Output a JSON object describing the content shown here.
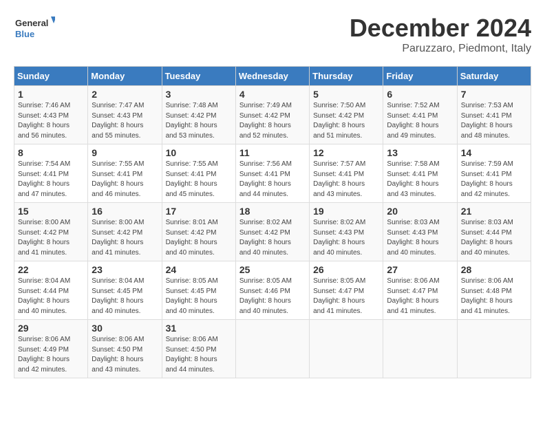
{
  "header": {
    "logo_line1": "General",
    "logo_line2": "Blue",
    "month": "December 2024",
    "location": "Paruzzaro, Piedmont, Italy"
  },
  "weekdays": [
    "Sunday",
    "Monday",
    "Tuesday",
    "Wednesday",
    "Thursday",
    "Friday",
    "Saturday"
  ],
  "weeks": [
    [
      {
        "day": "1",
        "sunrise": "7:46 AM",
        "sunset": "4:43 PM",
        "daylight": "8 hours and 56 minutes."
      },
      {
        "day": "2",
        "sunrise": "7:47 AM",
        "sunset": "4:43 PM",
        "daylight": "8 hours and 55 minutes."
      },
      {
        "day": "3",
        "sunrise": "7:48 AM",
        "sunset": "4:42 PM",
        "daylight": "8 hours and 53 minutes."
      },
      {
        "day": "4",
        "sunrise": "7:49 AM",
        "sunset": "4:42 PM",
        "daylight": "8 hours and 52 minutes."
      },
      {
        "day": "5",
        "sunrise": "7:50 AM",
        "sunset": "4:42 PM",
        "daylight": "8 hours and 51 minutes."
      },
      {
        "day": "6",
        "sunrise": "7:52 AM",
        "sunset": "4:41 PM",
        "daylight": "8 hours and 49 minutes."
      },
      {
        "day": "7",
        "sunrise": "7:53 AM",
        "sunset": "4:41 PM",
        "daylight": "8 hours and 48 minutes."
      }
    ],
    [
      {
        "day": "8",
        "sunrise": "7:54 AM",
        "sunset": "4:41 PM",
        "daylight": "8 hours and 47 minutes."
      },
      {
        "day": "9",
        "sunrise": "7:55 AM",
        "sunset": "4:41 PM",
        "daylight": "8 hours and 46 minutes."
      },
      {
        "day": "10",
        "sunrise": "7:55 AM",
        "sunset": "4:41 PM",
        "daylight": "8 hours and 45 minutes."
      },
      {
        "day": "11",
        "sunrise": "7:56 AM",
        "sunset": "4:41 PM",
        "daylight": "8 hours and 44 minutes."
      },
      {
        "day": "12",
        "sunrise": "7:57 AM",
        "sunset": "4:41 PM",
        "daylight": "8 hours and 43 minutes."
      },
      {
        "day": "13",
        "sunrise": "7:58 AM",
        "sunset": "4:41 PM",
        "daylight": "8 hours and 43 minutes."
      },
      {
        "day": "14",
        "sunrise": "7:59 AM",
        "sunset": "4:41 PM",
        "daylight": "8 hours and 42 minutes."
      }
    ],
    [
      {
        "day": "15",
        "sunrise": "8:00 AM",
        "sunset": "4:42 PM",
        "daylight": "8 hours and 41 minutes."
      },
      {
        "day": "16",
        "sunrise": "8:00 AM",
        "sunset": "4:42 PM",
        "daylight": "8 hours and 41 minutes."
      },
      {
        "day": "17",
        "sunrise": "8:01 AM",
        "sunset": "4:42 PM",
        "daylight": "8 hours and 40 minutes."
      },
      {
        "day": "18",
        "sunrise": "8:02 AM",
        "sunset": "4:42 PM",
        "daylight": "8 hours and 40 minutes."
      },
      {
        "day": "19",
        "sunrise": "8:02 AM",
        "sunset": "4:43 PM",
        "daylight": "8 hours and 40 minutes."
      },
      {
        "day": "20",
        "sunrise": "8:03 AM",
        "sunset": "4:43 PM",
        "daylight": "8 hours and 40 minutes."
      },
      {
        "day": "21",
        "sunrise": "8:03 AM",
        "sunset": "4:44 PM",
        "daylight": "8 hours and 40 minutes."
      }
    ],
    [
      {
        "day": "22",
        "sunrise": "8:04 AM",
        "sunset": "4:44 PM",
        "daylight": "8 hours and 40 minutes."
      },
      {
        "day": "23",
        "sunrise": "8:04 AM",
        "sunset": "4:45 PM",
        "daylight": "8 hours and 40 minutes."
      },
      {
        "day": "24",
        "sunrise": "8:05 AM",
        "sunset": "4:45 PM",
        "daylight": "8 hours and 40 minutes."
      },
      {
        "day": "25",
        "sunrise": "8:05 AM",
        "sunset": "4:46 PM",
        "daylight": "8 hours and 40 minutes."
      },
      {
        "day": "26",
        "sunrise": "8:05 AM",
        "sunset": "4:47 PM",
        "daylight": "8 hours and 41 minutes."
      },
      {
        "day": "27",
        "sunrise": "8:06 AM",
        "sunset": "4:47 PM",
        "daylight": "8 hours and 41 minutes."
      },
      {
        "day": "28",
        "sunrise": "8:06 AM",
        "sunset": "4:48 PM",
        "daylight": "8 hours and 41 minutes."
      }
    ],
    [
      {
        "day": "29",
        "sunrise": "8:06 AM",
        "sunset": "4:49 PM",
        "daylight": "8 hours and 42 minutes."
      },
      {
        "day": "30",
        "sunrise": "8:06 AM",
        "sunset": "4:50 PM",
        "daylight": "8 hours and 43 minutes."
      },
      {
        "day": "31",
        "sunrise": "8:06 AM",
        "sunset": "4:50 PM",
        "daylight": "8 hours and 44 minutes."
      },
      null,
      null,
      null,
      null
    ]
  ],
  "labels": {
    "sunrise_prefix": "Sunrise: ",
    "sunset_prefix": "Sunset: ",
    "daylight_prefix": "Daylight: "
  }
}
